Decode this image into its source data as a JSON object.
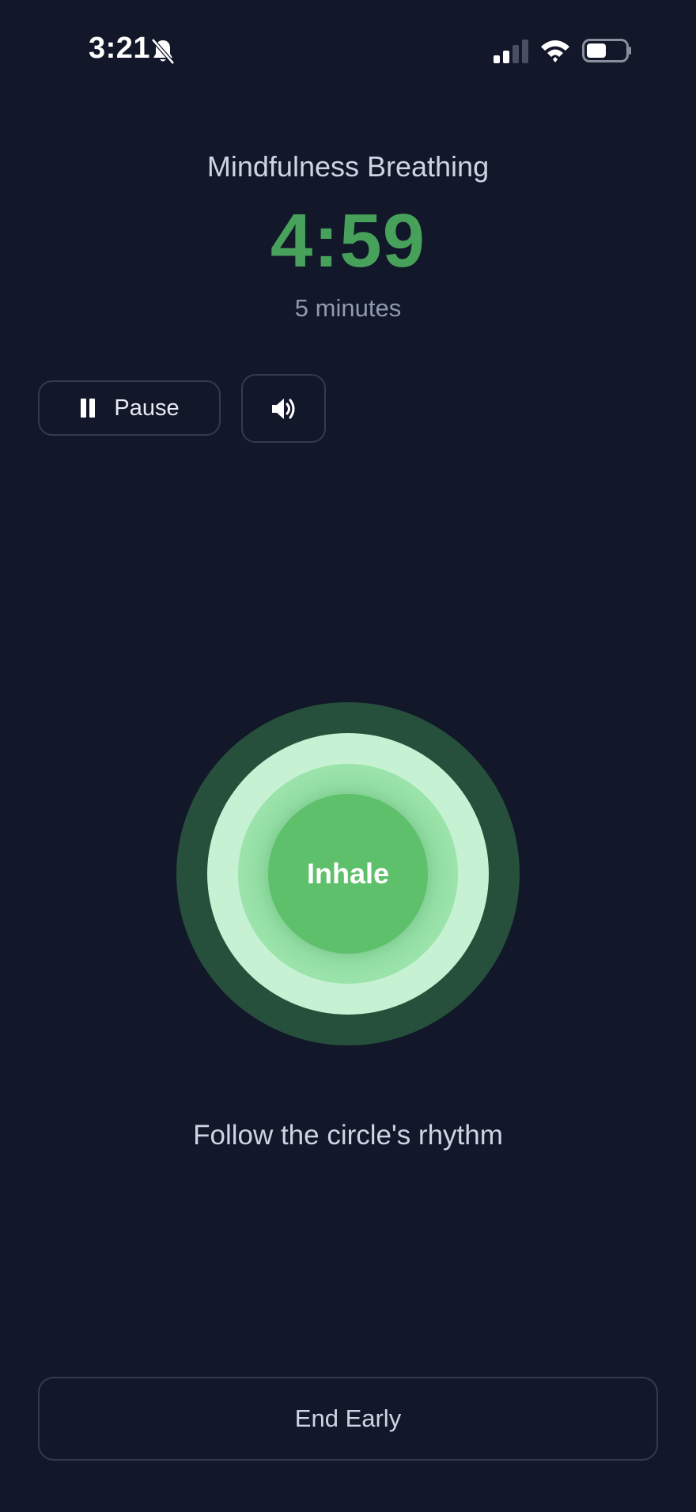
{
  "status_bar": {
    "time": "3:21",
    "icons": [
      "bell-slash-icon",
      "cellular-signal-icon",
      "wifi-icon",
      "battery-icon"
    ]
  },
  "session": {
    "title": "Mindfulness Breathing",
    "timer": "4:59",
    "duration": "5 minutes"
  },
  "controls": {
    "pause_label": "Pause",
    "pause_icon": "pause-icon",
    "sound_icon": "speaker-icon"
  },
  "breathing": {
    "phase": "Inhale",
    "instruction": "Follow the circle's rhythm"
  },
  "footer": {
    "end_label": "End Early"
  },
  "colors": {
    "background": "#121729",
    "accent": "#47a15a",
    "circle_core": "#5fc06b",
    "circle_outer": "#26503c",
    "circle_light": "#c6f1d2"
  }
}
